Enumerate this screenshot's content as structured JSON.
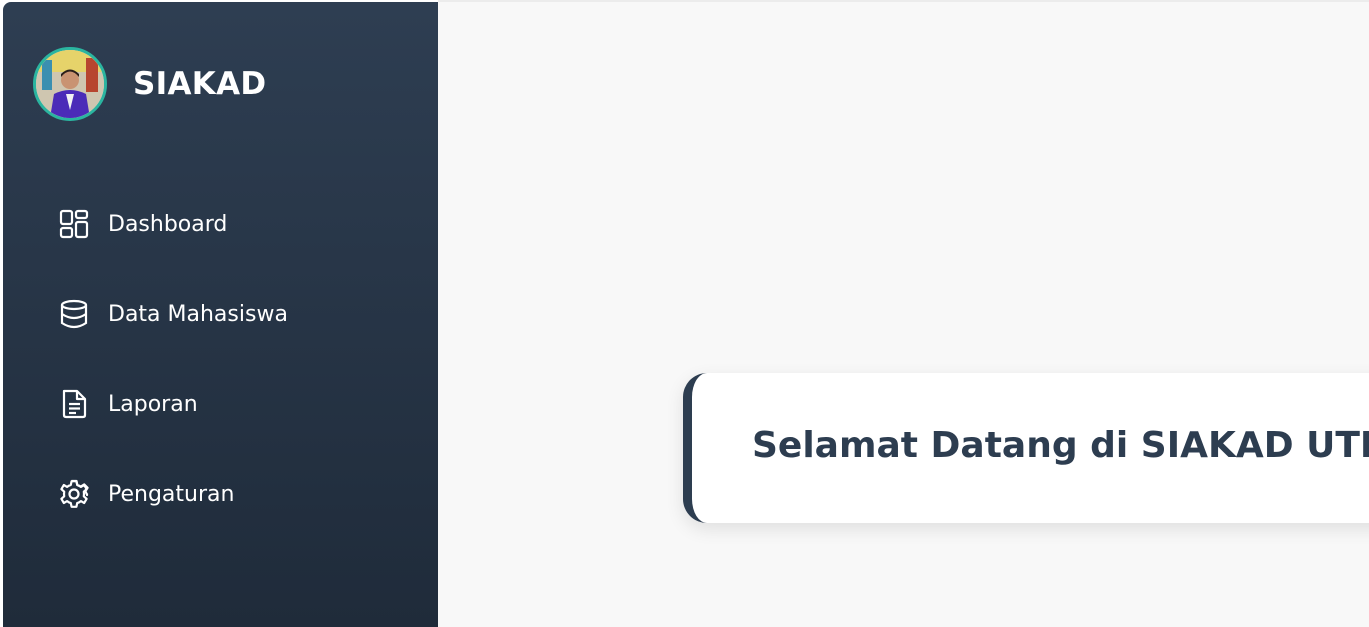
{
  "brand": {
    "title": "SIAKAD",
    "avatar_icon": "user-photo-avatar",
    "accent_color": "#2bb5a0"
  },
  "sidebar": {
    "background_top": "#2e3e52",
    "background_bottom": "#1f2b3a",
    "items": [
      {
        "label": "Dashboard",
        "icon": "dashboard-grid-icon"
      },
      {
        "label": "Data Mahasiswa",
        "icon": "database-icon"
      },
      {
        "label": "Laporan",
        "icon": "document-icon"
      },
      {
        "label": "Pengaturan",
        "icon": "gear-icon"
      }
    ]
  },
  "main": {
    "welcome": "Selamat Datang di SIAKAD UTM",
    "background": "#f8f8f8",
    "text_color": "#2d3d50"
  }
}
